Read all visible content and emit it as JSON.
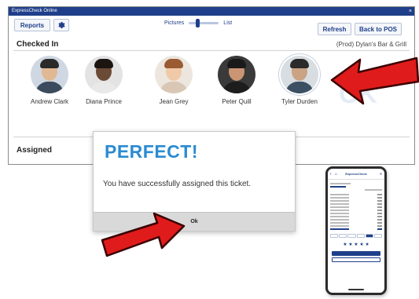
{
  "window": {
    "title": "ExpressCheck Online",
    "close_glyph": "×"
  },
  "toolbar": {
    "reports_label": "Reports",
    "settings_icon": "gear-icon",
    "view_toggle": {
      "left_label": "Pictures",
      "right_label": "List"
    },
    "refresh_label": "Refresh",
    "back_to_pos_label": "Back to POS"
  },
  "checked_in": {
    "title": "Checked In",
    "location": "(Prod) Dylan's Bar & Grill",
    "people": [
      {
        "name": "Andrew Clark",
        "skin": "#e0b893",
        "hair": "#2a2a2a",
        "shirt": "#3b4a5c",
        "bg": "#cfd7e2"
      },
      {
        "name": "Diana Prince",
        "skin": "#6b4a36",
        "hair": "#1c1410",
        "shirt": "#e9e9e9",
        "bg": "#e3e3e3"
      },
      {
        "name": "Jean Grey",
        "skin": "#f0c9a8",
        "hair": "#9a5a32",
        "shirt": "#d9c7b5",
        "bg": "#ece6df"
      },
      {
        "name": "Peter Quill",
        "skin": "#c99572",
        "hair": "#1a1a1a",
        "shirt": "#1d1d1d",
        "bg": "#3a3a3a"
      },
      {
        "name": "Tyler Durden",
        "skin": "#c9a383",
        "hair": "#2b2b2b",
        "shirt": "#3c4f63",
        "bg": "#d8dde2"
      }
    ],
    "selected_index": 4,
    "watermark": "CK"
  },
  "assigned": {
    "title": "Assigned"
  },
  "modal": {
    "title": "PERFECT!",
    "message": "You have successfully assigned this ticket.",
    "ok_label": "Ok"
  },
  "phone": {
    "header_title": "ExpressCheck",
    "info_lines": [
      "",
      "",
      ""
    ],
    "tip_options": 6,
    "active_tip": 4,
    "stars": "★ ★ ★ ★ ★"
  },
  "colors": {
    "brand_blue": "#1f3f8a",
    "title_blue": "#2a8bd1",
    "arrow_red": "#e01b1b"
  }
}
